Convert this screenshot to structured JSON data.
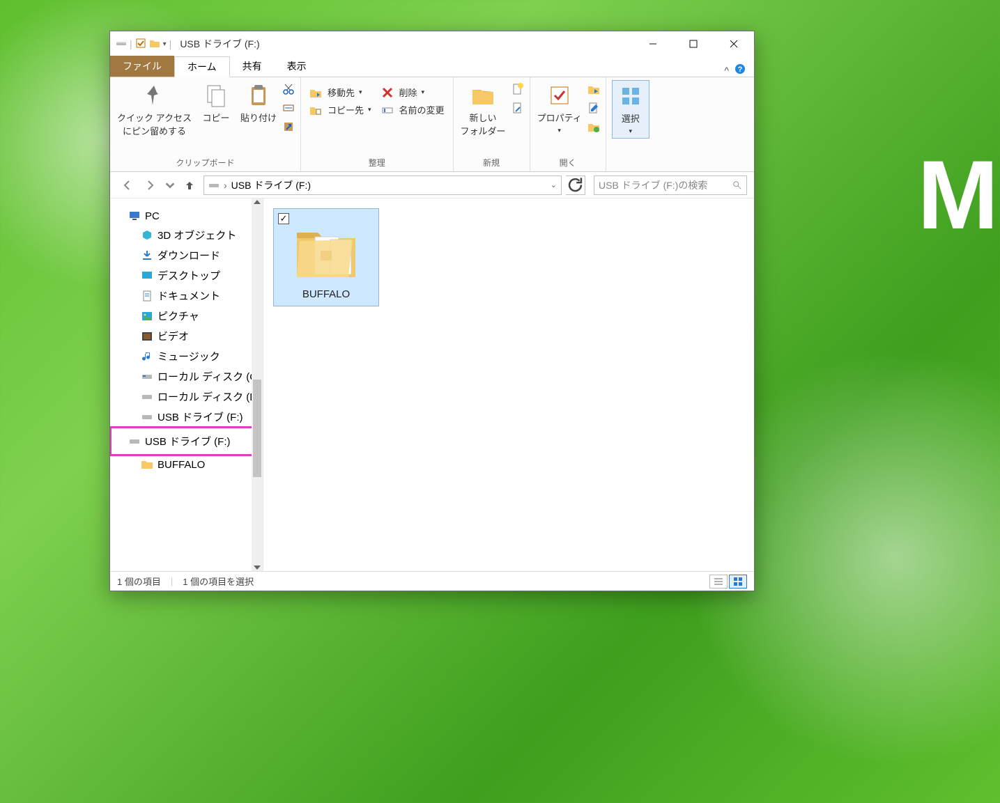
{
  "window": {
    "title": "USB ドライブ (F:)"
  },
  "tabs": {
    "file": "ファイル",
    "home": "ホーム",
    "share": "共有",
    "view": "表示"
  },
  "ribbon": {
    "clipboard": {
      "pin": "クイック アクセス\nにピン留めする",
      "copy": "コピー",
      "paste": "貼り付け",
      "label": "クリップボード"
    },
    "organize": {
      "moveTo": "移動先",
      "copyTo": "コピー先",
      "delete": "削除",
      "rename": "名前の変更",
      "label": "整理"
    },
    "new": {
      "newFolder": "新しい\nフォルダー",
      "label": "新規"
    },
    "open": {
      "properties": "プロパティ",
      "label": "開く"
    },
    "select": {
      "select": "選択"
    }
  },
  "address": {
    "path": "USB ドライブ (F:)"
  },
  "search": {
    "placeholder": "USB ドライブ (F:)の検索"
  },
  "tree": {
    "pc": "PC",
    "objects3d": "3D オブジェクト",
    "downloads": "ダウンロード",
    "desktop": "デスクトップ",
    "documents": "ドキュメント",
    "pictures": "ピクチャ",
    "videos": "ビデオ",
    "music": "ミュージック",
    "localC": "ローカル ディスク (C",
    "localD": "ローカル ディスク (D",
    "usbF1": "USB ドライブ (F:)",
    "usbF2": "USB ドライブ (F:)",
    "buffalo": "BUFFALO"
  },
  "content": {
    "items": [
      {
        "name": "BUFFALO",
        "selected": true
      }
    ]
  },
  "status": {
    "count": "1 個の項目",
    "selected": "1 個の項目を選択"
  }
}
